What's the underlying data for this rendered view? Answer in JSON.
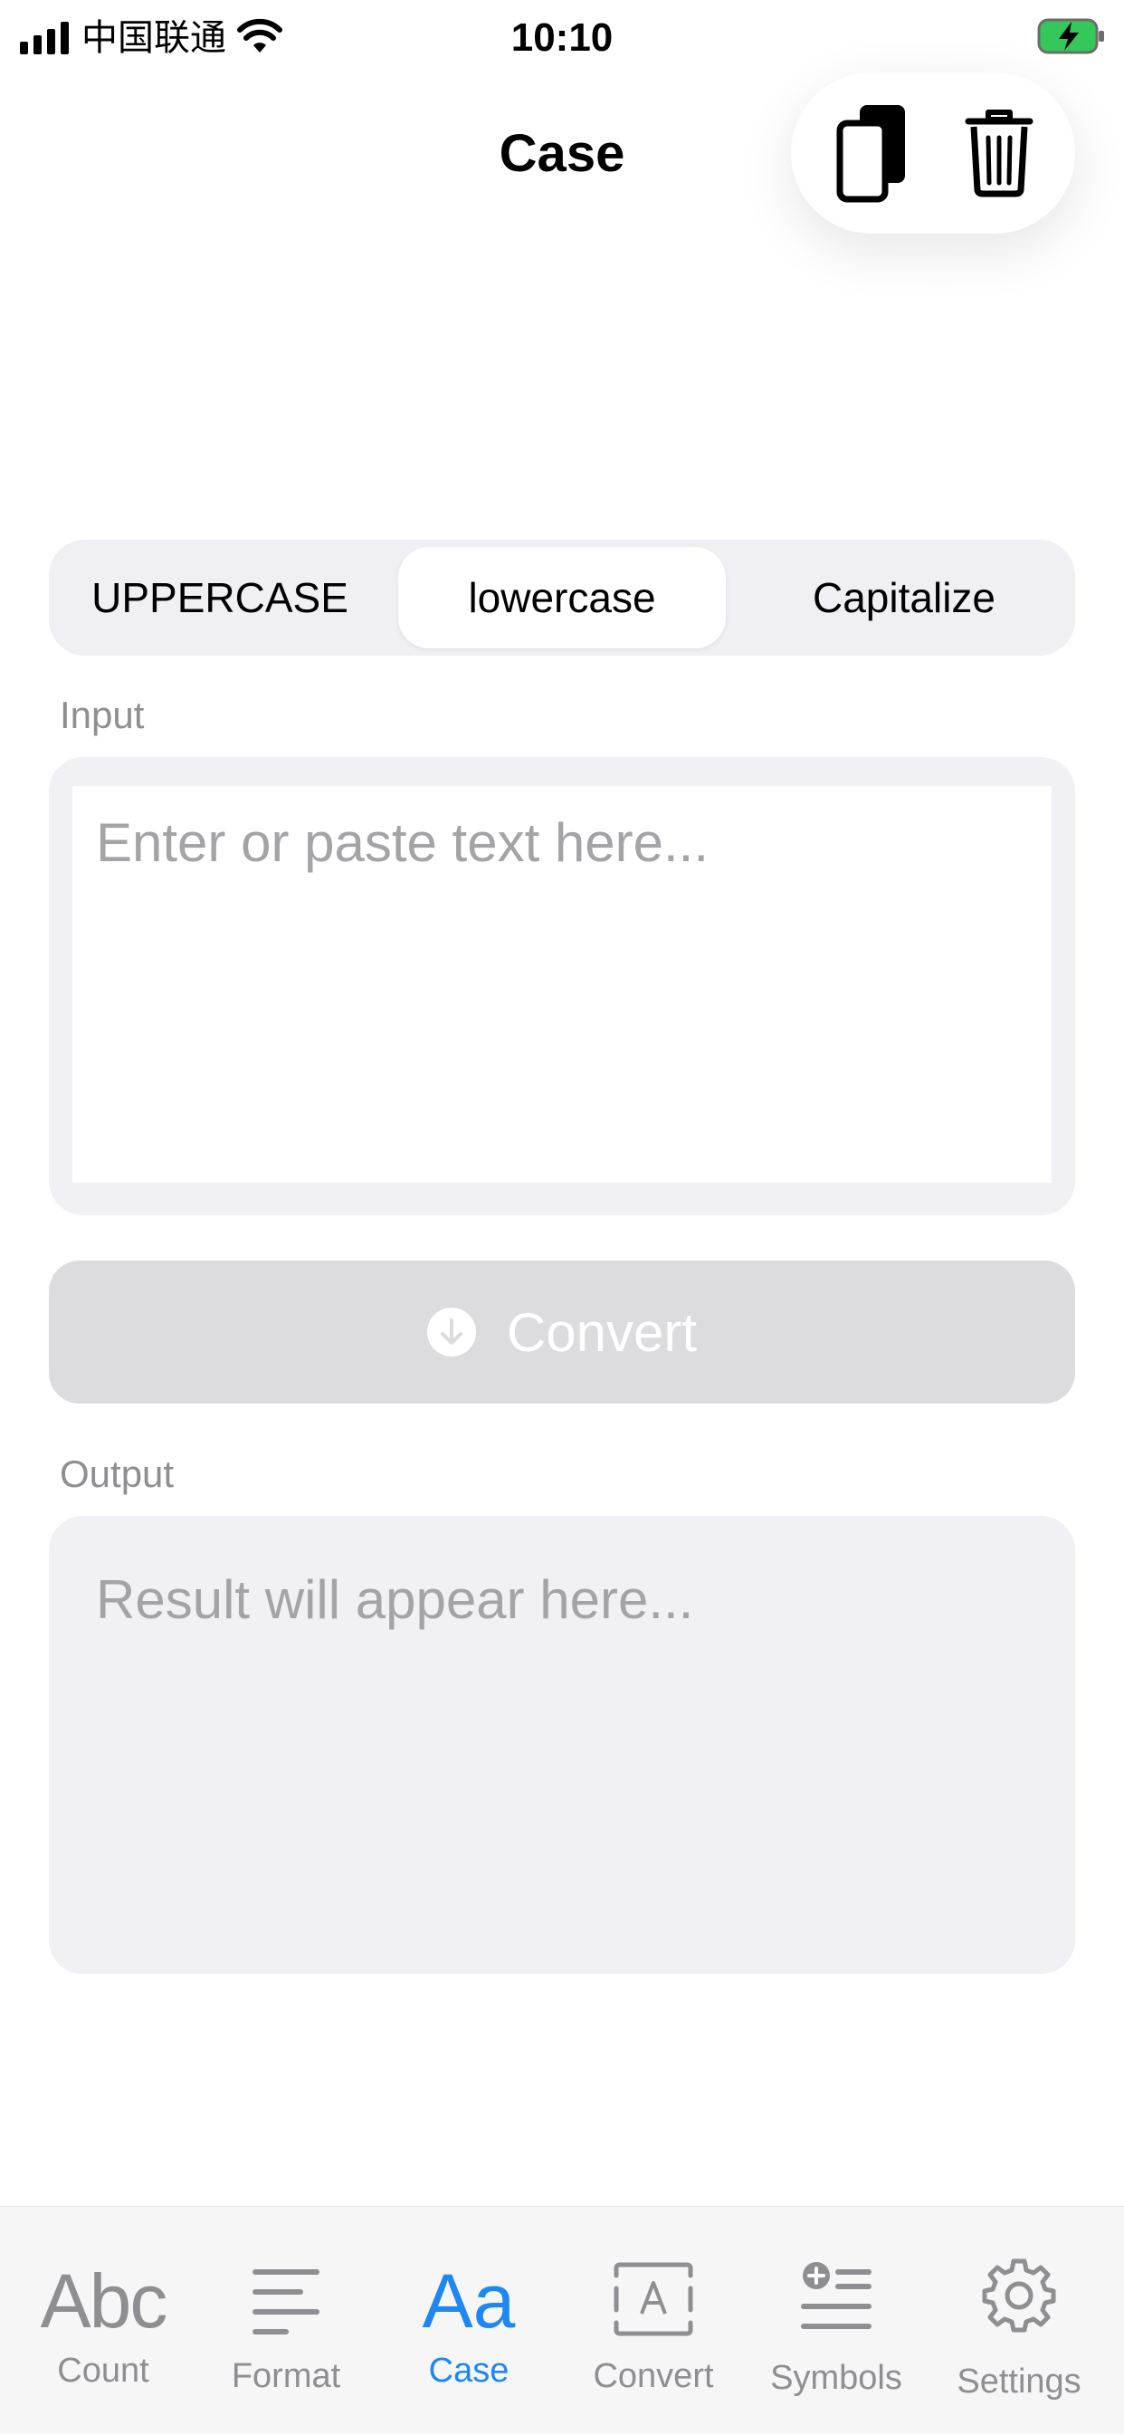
{
  "status_bar": {
    "carrier": "中国联通",
    "time": "10:10"
  },
  "header": {
    "title": "Case"
  },
  "case_options": [
    {
      "label": "UPPERCASE",
      "selected": false
    },
    {
      "label": "lowercase",
      "selected": true
    },
    {
      "label": "Capitalize",
      "selected": false
    }
  ],
  "input": {
    "label": "Input",
    "value": "",
    "placeholder": "Enter or paste text here..."
  },
  "convert": {
    "label": "Convert"
  },
  "output": {
    "label": "Output",
    "placeholder": "Result will appear here..."
  },
  "tabs": [
    {
      "label": "Count",
      "icon": "abc-icon",
      "active": false
    },
    {
      "label": "Format",
      "icon": "text-align-icon",
      "active": false
    },
    {
      "label": "Case",
      "icon": "aa-icon",
      "active": true
    },
    {
      "label": "Convert",
      "icon": "text-box-icon",
      "active": false
    },
    {
      "label": "Symbols",
      "icon": "plus-list-icon",
      "active": false
    },
    {
      "label": "Settings",
      "icon": "gear-icon",
      "active": false
    }
  ],
  "colors": {
    "accent": "#1E87F0",
    "inactive": "#8E8E93",
    "field_bg": "#F0F0F5",
    "button_disabled": "#DCDCDE"
  },
  "glyphs": {
    "count_tab": "Abc",
    "case_tab": "Aa"
  }
}
